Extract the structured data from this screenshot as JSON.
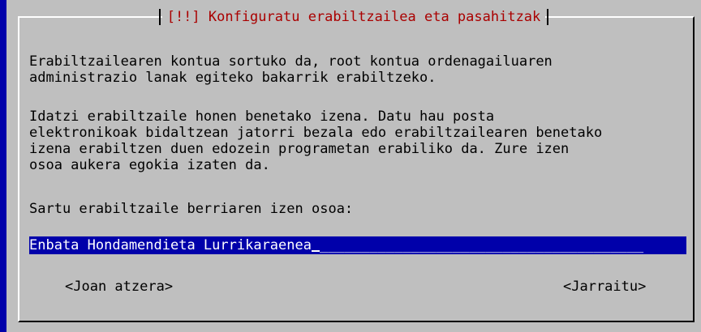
{
  "dialog": {
    "title": "[!!] Konfiguratu erabiltzailea eta pasahitzak",
    "intro": "Erabiltzailearen kontua sortuko da, root kontua ordenagailuaren\nadministrazio lanak egiteko bakarrik erabiltzeko.",
    "details": "Idatzi erabiltzaile honen benetako izena. Datu hau posta\nelektronikoak bidaltzean jatorri bezala edo erabiltzailearen benetako\nizena erabiltzen duen edozein programetan erabiliko da. Zure izen\nosoa aukera egokia izaten da.",
    "prompt": "Sartu erabiltzaile berriaren izen osoa:",
    "fullname_value": "Enbata Hondamendieta Lurrikaraenea",
    "back_label": "<Joan atzera>",
    "continue_label": "<Jarraitu>"
  },
  "colors": {
    "background": "#0000aa",
    "dialog": "#bfbfbf",
    "title": "#aa0000",
    "entry": "#0000aa"
  }
}
